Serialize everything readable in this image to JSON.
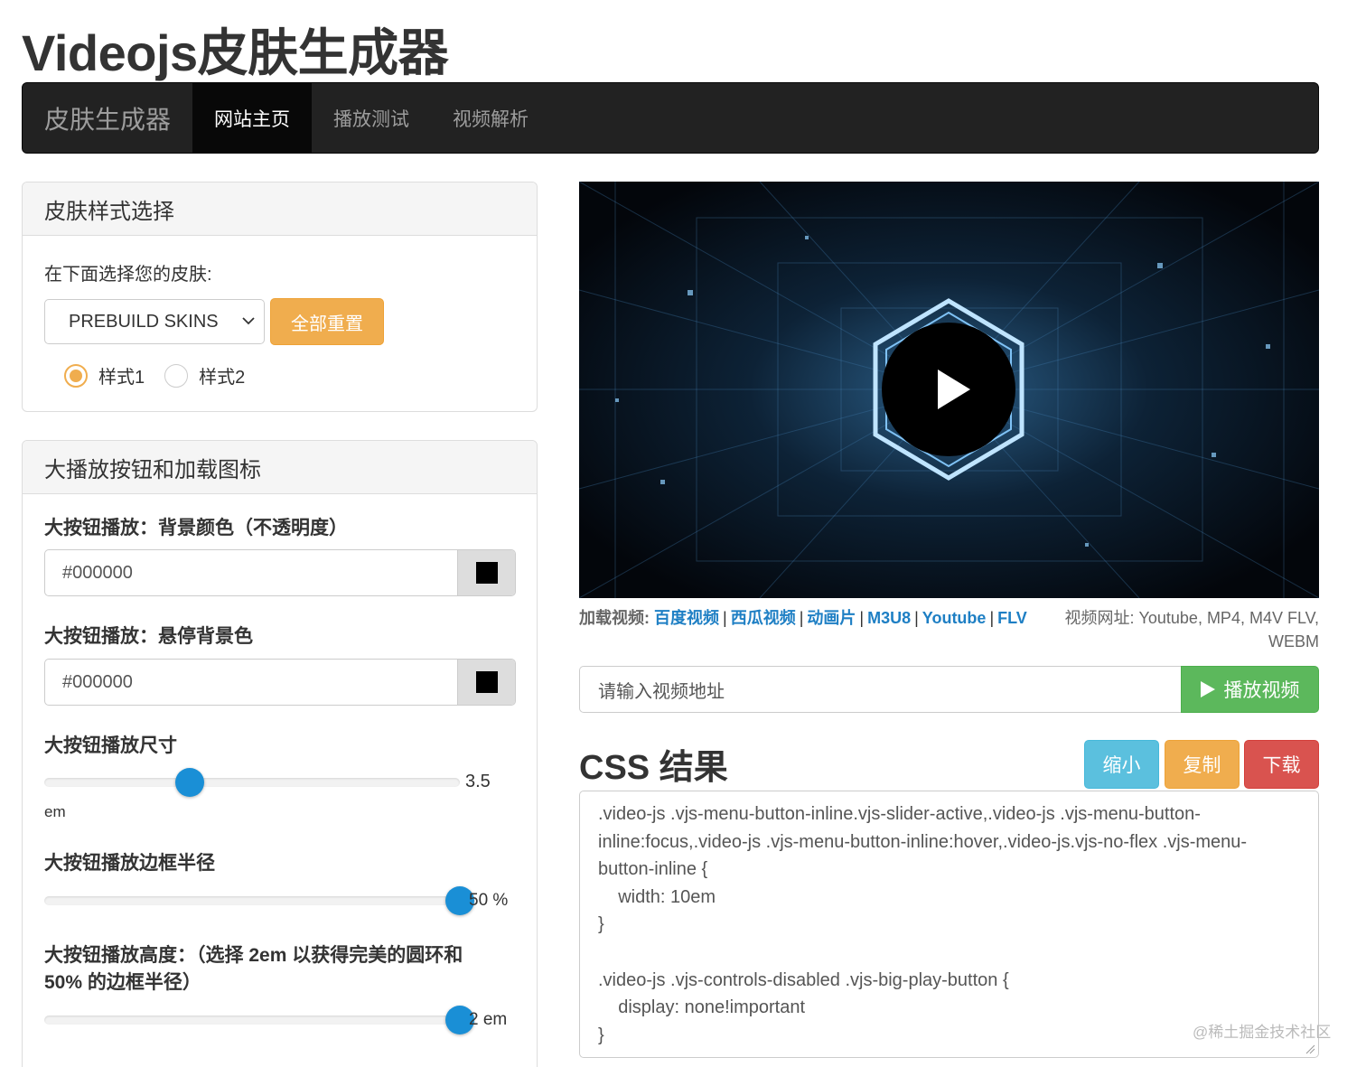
{
  "title": "Videojs皮肤生成器",
  "navbar": {
    "brand": "皮肤生成器",
    "items": [
      {
        "label": "网站主页",
        "active": true
      },
      {
        "label": "播放测试",
        "active": false
      },
      {
        "label": "视频解析",
        "active": false
      }
    ]
  },
  "skin_panel": {
    "heading": "皮肤样式选择",
    "select_label": "在下面选择您的皮肤:",
    "select_value": "PREBUILD SKINS",
    "reset_button": "全部重置",
    "radios": [
      {
        "label": "样式1",
        "checked": true
      },
      {
        "label": "样式2",
        "checked": false
      }
    ]
  },
  "play_panel": {
    "heading": "大播放按钮和加载图标",
    "bg_label": "大按钮播放：背景颜色（不透明度）",
    "bg_value": "#000000",
    "hover_label": "大按钮播放：悬停背景色",
    "hover_value": "#000000",
    "size_label": "大按钮播放尺寸",
    "size_value": "3.5",
    "size_unit": "em",
    "size_fraction": 0.35,
    "radius_label": "大按钮播放边框半径",
    "radius_value": "50 %",
    "radius_fraction": 1.0,
    "height_label": "大按钮播放高度：（选择 2em 以获得完美的圆环和50% 的边框半径）",
    "height_value": "2 em",
    "height_fraction": 1.0,
    "swatch_color": "#000000"
  },
  "video": {
    "load_lead": "加载视频:",
    "sources": [
      "百度视频",
      "西瓜视频",
      "动画片",
      "M3U8",
      "Youtube",
      "FLV"
    ],
    "formats_hint": "视频网址: Youtube, MP4, M4V FLV, WEBM",
    "url_placeholder": "请输入视频地址",
    "play_button": "播放视频"
  },
  "css_result": {
    "title": "CSS 结果",
    "shrink_button": "缩小",
    "copy_button": "复制",
    "download_button": "下载",
    "code": ".video-js .vjs-menu-button-inline.vjs-slider-active,.video-js .vjs-menu-button-inline:focus,.video-js .vjs-menu-button-inline:hover,.video-js.vjs-no-flex .vjs-menu-button-inline {\n    width: 10em\n}\n\n.video-js .vjs-controls-disabled .vjs-big-play-button {\n    display: none!important\n}"
  },
  "watermark": "@稀土掘金技术社区",
  "colors": {
    "navbar_bg": "#222222",
    "warning": "#f0ad4e",
    "success": "#5cb85c",
    "info": "#5bc0de",
    "danger": "#d9534f",
    "link": "#1e7fc4",
    "slider_knob": "#1a8fd6"
  }
}
